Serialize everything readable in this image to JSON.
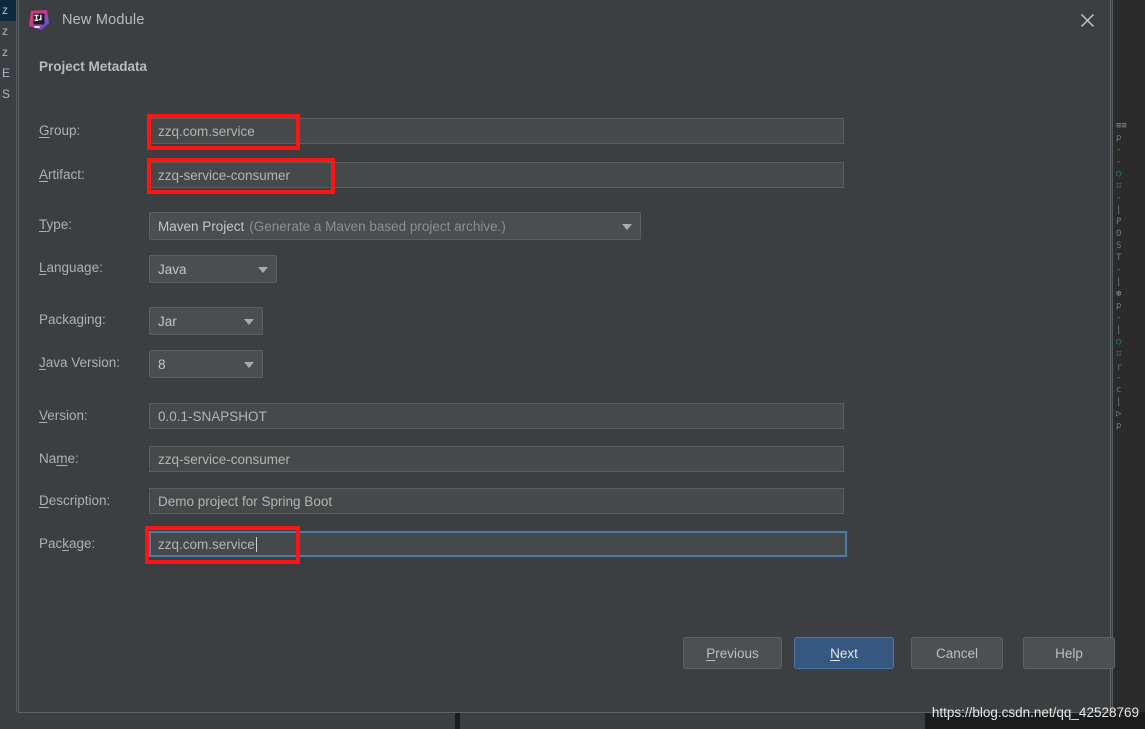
{
  "window": {
    "title": "New Module",
    "app_icon": "intellij-idea-icon",
    "close_icon": "close-icon"
  },
  "dialog": {
    "section_header": "Project Metadata",
    "fields": [
      {
        "id": "group",
        "label": "Group:",
        "mnemonic": "G",
        "control": "text",
        "value": "zzq.com.service",
        "annotated": true,
        "focused": false
      },
      {
        "id": "artifact",
        "label": "Artifact:",
        "mnemonic": "A",
        "control": "text",
        "value": "zzq-service-consumer",
        "annotated": true,
        "focused": false
      },
      {
        "id": "type",
        "label": "Type:",
        "mnemonic": "T",
        "control": "combo",
        "value": "Maven Project",
        "hint": "(Generate a Maven based project archive.)",
        "annotated": false,
        "focused": false
      },
      {
        "id": "language",
        "label": "Language:",
        "mnemonic": "L",
        "control": "combo",
        "value": "Java",
        "annotated": false,
        "focused": false
      },
      {
        "id": "packaging",
        "label": "Packaging:",
        "mnemonic": "g",
        "control": "combo",
        "value": "Jar",
        "annotated": false,
        "focused": false
      },
      {
        "id": "java-version",
        "label": "Java Version:",
        "mnemonic": "J",
        "control": "combo",
        "value": "8",
        "annotated": false,
        "focused": false
      },
      {
        "id": "version",
        "label": "Version:",
        "mnemonic": "V",
        "control": "text",
        "value": "0.0.1-SNAPSHOT",
        "annotated": false,
        "focused": false
      },
      {
        "id": "name",
        "label": "Name:",
        "mnemonic": "m",
        "control": "text",
        "value": "zzq-service-consumer",
        "annotated": false,
        "focused": false
      },
      {
        "id": "description",
        "label": "Description:",
        "mnemonic": "D",
        "control": "text",
        "value": "Demo project for Spring Boot",
        "annotated": false,
        "focused": false
      },
      {
        "id": "package",
        "label": "Package:",
        "mnemonic": "k",
        "control": "text",
        "value": "zzq.com.service",
        "annotated": true,
        "focused": true
      }
    ],
    "buttons": [
      {
        "id": "previous",
        "label": "Previous",
        "mnemonic": "P",
        "primary": false
      },
      {
        "id": "next",
        "label": "Next",
        "mnemonic": "N",
        "primary": true
      },
      {
        "id": "cancel",
        "label": "Cancel",
        "mnemonic": "",
        "primary": false
      },
      {
        "id": "help",
        "label": "Help",
        "mnemonic": "",
        "primary": false
      }
    ]
  },
  "watermark": {
    "text": "https://blog.csdn.net/qq_42528769"
  },
  "background": {
    "project_tree": [
      {
        "text": "z",
        "selected": true
      },
      {
        "text": "z",
        "selected": false
      },
      {
        "text": "z",
        "selected": false
      },
      {
        "text": "E",
        "selected": false
      },
      {
        "text": "S",
        "selected": false
      }
    ],
    "editor_minimap": [
      {
        "text": "≡≡",
        "style": "bright"
      },
      {
        "text": "p",
        "style": ""
      },
      {
        "text": "-",
        "style": "warn"
      },
      {
        "text": "-",
        "style": ""
      },
      {
        "text": "○",
        "style": "accent"
      },
      {
        "text": "∷",
        "style": ""
      },
      {
        "text": "-",
        "style": ""
      },
      {
        "text": "|",
        "style": ""
      },
      {
        "text": "P",
        "style": ""
      },
      {
        "text": "O",
        "style": ""
      },
      {
        "text": "S",
        "style": ""
      },
      {
        "text": "T",
        "style": ""
      },
      {
        "text": "-",
        "style": "warn"
      },
      {
        "text": "|",
        "style": ""
      },
      {
        "text": "❇",
        "style": "bright"
      },
      {
        "text": "p",
        "style": ""
      },
      {
        "text": "-",
        "style": "warn"
      },
      {
        "text": "|",
        "style": ""
      },
      {
        "text": "○",
        "style": "accent"
      },
      {
        "text": "∷",
        "style": ""
      },
      {
        "text": "┌",
        "style": ""
      },
      {
        "text": "-",
        "style": "warn"
      },
      {
        "text": "c",
        "style": ""
      },
      {
        "text": "|",
        "style": ""
      },
      {
        "text": "▷",
        "style": "bright"
      },
      {
        "text": "p",
        "style": ""
      }
    ]
  },
  "colors": {
    "dialog_bg": "#3c3f41",
    "field_bg": "#45494a",
    "primary_button": "#365880",
    "focus_border": "#4b7ba8",
    "annotation": "#ff1414",
    "text": "#b0b0b0"
  }
}
